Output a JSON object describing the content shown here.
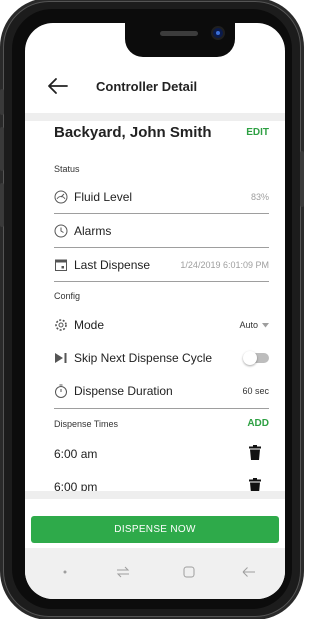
{
  "header": {
    "title": "Controller Detail"
  },
  "controller": {
    "name": "Backyard, John Smith",
    "edit_label": "EDIT"
  },
  "status": {
    "section_label": "Status",
    "fluid_level_label": "Fluid Level",
    "fluid_level_value": "83%",
    "alarms_label": "Alarms",
    "last_dispense_label": "Last Dispense",
    "last_dispense_value": "1/24/2019 6:01:09 PM"
  },
  "config": {
    "section_label": "Config",
    "mode_label": "Mode",
    "mode_value": "Auto",
    "skip_label": "Skip Next Dispense Cycle",
    "skip_enabled": false,
    "duration_label": "Dispense Duration",
    "duration_value": "60 sec"
  },
  "dispense_times": {
    "section_label": "Dispense Times",
    "add_label": "ADD",
    "items": [
      {
        "time": "6:00 am"
      },
      {
        "time": "6:00 pm"
      }
    ]
  },
  "dispense_button": {
    "label": "DISPENSE NOW"
  },
  "colors": {
    "accent": "#2eaa4a",
    "link": "#2ea043",
    "divider": "#9e9e9e"
  },
  "icons": [
    "back-arrow-icon",
    "gauge-icon",
    "clock-icon",
    "calendar-icon",
    "gear-icon",
    "skip-next-icon",
    "timer-icon",
    "trash-icon",
    "overview-icon",
    "recents-icon",
    "home-icon",
    "back-nav-icon"
  ]
}
